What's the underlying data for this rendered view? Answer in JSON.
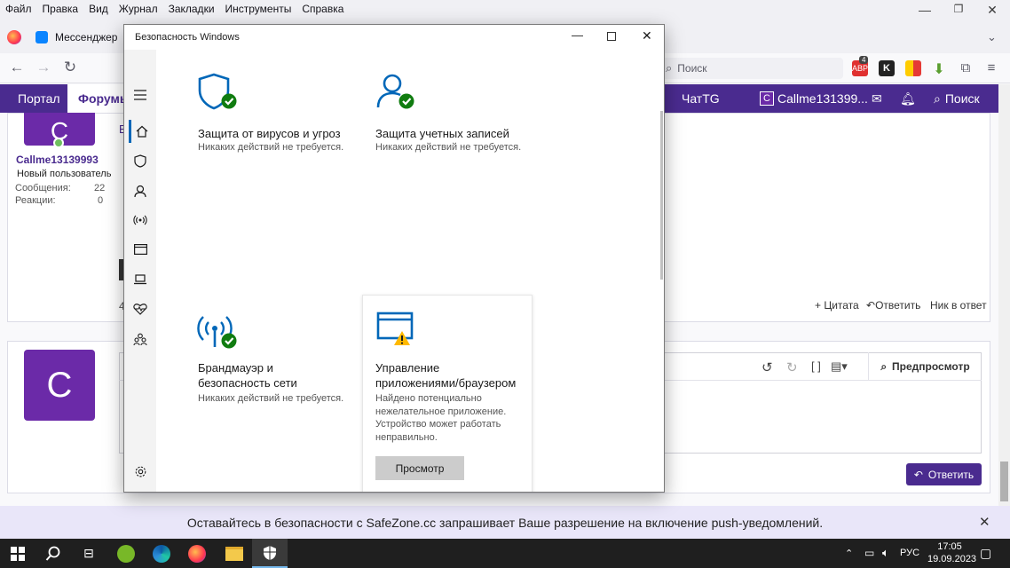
{
  "browser": {
    "menu": [
      "Файл",
      "Правка",
      "Вид",
      "Журнал",
      "Закладки",
      "Инструменты",
      "Справка"
    ],
    "tab_label": "Мессенджер",
    "search_placeholder": "Поиск",
    "extension_badge": "4"
  },
  "forum": {
    "nav": {
      "portal": "Портал",
      "forums": "Форумы",
      "chat": "ЧатTG",
      "user": "Callme131399...",
      "search": "Поиск"
    },
    "post": {
      "avatar_letter": "C",
      "username": "Callme13139993",
      "role": "Новый пользователь",
      "messages_label": "Сообщения:",
      "messages_value": "22",
      "reactions_label": "Реакции:",
      "reactions_value": "0",
      "partial_text_1": "В",
      "partial_text_2": "4",
      "quote": "+ Цитата",
      "reply": "Ответить",
      "nick_reply": "Ник в ответ"
    },
    "editor": {
      "avatar_letter": "C",
      "preview": "Предпросмотр",
      "submit": "Ответить"
    }
  },
  "push_notice": {
    "text": "Оставайтесь в безопасности с SafeZone.cc запрашивает Ваше разрешение на включение push-уведомлений."
  },
  "security": {
    "window_title": "Безопасность Windows",
    "tiles": [
      {
        "title": "Защита от вирусов и угроз",
        "subtitle": "Никаких действий не требуется."
      },
      {
        "title": "Защита учетных записей",
        "subtitle": "Никаких действий не требуется."
      },
      {
        "title_line1": "Брандмауэр и",
        "title_line2": "безопасность сети",
        "subtitle": "Никаких действий не требуется."
      },
      {
        "title_line1": "Управление",
        "title_line2": "приложениями/браузером",
        "sub1": "Найдено потенциально",
        "sub2": "нежелательное приложение.",
        "sub3": "Устройство может работать",
        "sub4": "неправильно.",
        "button": "Просмотр"
      }
    ]
  },
  "taskbar": {
    "language": "РУС",
    "time": "17:05",
    "date": "19.09.2023"
  },
  "colors": {
    "forum_nav": "#4a2b8f",
    "avatar": "#6b2aa8",
    "defender_blue": "#0067b8",
    "ok_green": "#107c10",
    "warning_yellow": "#ffb900"
  }
}
